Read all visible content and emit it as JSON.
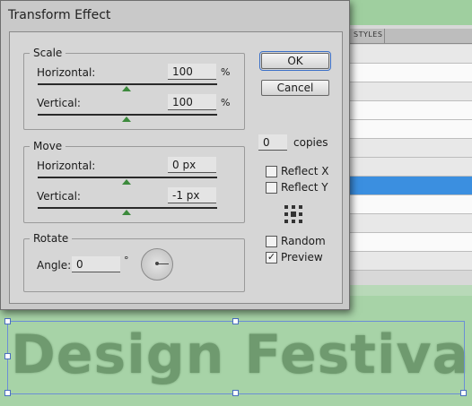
{
  "dialog": {
    "title": "Transform Effect",
    "scale": {
      "legend": "Scale",
      "horizontal_label": "Horizontal:",
      "horizontal_value": "100",
      "horizontal_unit": "%",
      "vertical_label": "Vertical:",
      "vertical_value": "100",
      "vertical_unit": "%"
    },
    "move": {
      "legend": "Move",
      "horizontal_label": "Horizontal:",
      "horizontal_value": "0 px",
      "vertical_label": "Vertical:",
      "vertical_value": "-1 px"
    },
    "rotate": {
      "legend": "Rotate",
      "angle_label": "Angle:",
      "angle_value": "0",
      "angle_unit": "°"
    },
    "buttons": {
      "ok": "OK",
      "cancel": "Cancel"
    },
    "copies": {
      "value": "0",
      "label": "copies"
    },
    "options": {
      "reflect_x": {
        "label": "Reflect X",
        "checked": false
      },
      "reflect_y": {
        "label": "Reflect Y",
        "checked": false
      },
      "random": {
        "label": "Random",
        "checked": false
      },
      "preview": {
        "label": "Preview",
        "checked": true
      }
    }
  },
  "background": {
    "panel_tab": "STYLES",
    "artwork_text": "Design Festival"
  },
  "colors": {
    "slider_thumb": "#3c8a3c",
    "selection_row": "#3b8fe0",
    "canvas": "#a7d3a7",
    "artwork_text": "#6f9a6f"
  }
}
